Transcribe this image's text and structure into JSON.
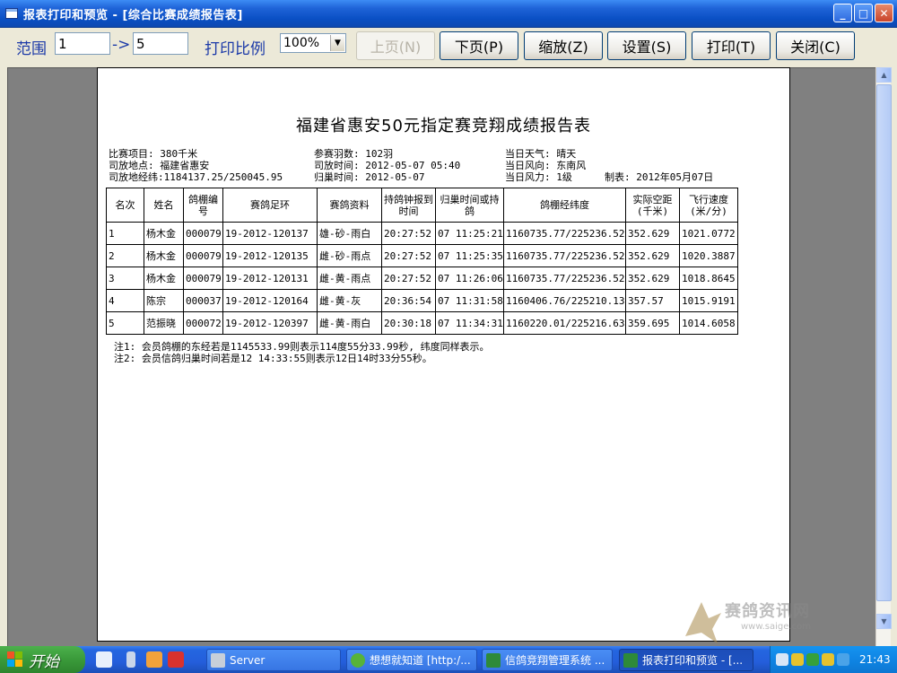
{
  "window": {
    "title": "报表打印和预览 - [综合比赛成绩报告表]",
    "minimize": "_",
    "maximize": "□",
    "close": "✕"
  },
  "toolbar": {
    "range_label": "范围",
    "range_from": "1",
    "range_arrow": "->",
    "range_to": "5",
    "scale_label": "打印比例",
    "scale_value": "100%",
    "prev_page": "上页(N)",
    "next_page": "下页(P)",
    "zoom": "缩放(Z)",
    "settings": "设置(S)",
    "print": "打印(T)",
    "close": "关闭(C)"
  },
  "report": {
    "title": "福建省惠安50元指定赛竞翔成绩报告表",
    "info_left": [
      "比赛项目: 380千米",
      "司放地点: 福建省惠安",
      "司放地经纬:1184137.25/250045.95"
    ],
    "info_mid": [
      "参赛羽数: 102羽",
      "司放时间: 2012-05-07 05:40",
      "归巢时间: 2012-05-07"
    ],
    "info_right": [
      "当日天气: 晴天",
      "当日风向: 东南风",
      "当日风力: 1级"
    ],
    "made_on": "制表: 2012年05月07日",
    "columns": [
      "名次",
      "姓名",
      "鸽棚编号",
      "赛鸽足环",
      "赛鸽资料",
      "持鸽钟报到时间",
      "归巢时间或持鸽",
      "鸽棚经纬度",
      "实际空距(千米)",
      "飞行速度(米/分)"
    ],
    "rows": [
      [
        "1",
        "杨木金",
        "000079",
        "19-2012-120137",
        "雄-砂-雨白",
        "20:27:52",
        "07 11:25:21",
        "1160735.77/225236.52",
        "352.629",
        "1021.0772"
      ],
      [
        "2",
        "杨木金",
        "000079",
        "19-2012-120135",
        "雌-砂-雨点",
        "20:27:52",
        "07 11:25:35",
        "1160735.77/225236.52",
        "352.629",
        "1020.3887"
      ],
      [
        "3",
        "杨木金",
        "000079",
        "19-2012-120131",
        "雌-黄-雨点",
        "20:27:52",
        "07 11:26:06",
        "1160735.77/225236.52",
        "352.629",
        "1018.8645"
      ],
      [
        "4",
        "陈宗",
        "000037",
        "19-2012-120164",
        "雌-黄-灰",
        "20:36:54",
        "07 11:31:58",
        "1160406.76/225210.13",
        "357.57",
        "1015.9191"
      ],
      [
        "5",
        "范振晓",
        "000072",
        "19-2012-120397",
        "雌-黄-雨白",
        "20:30:18",
        "07 11:34:31",
        "1160220.01/225216.63",
        "359.695",
        "1014.6058"
      ]
    ],
    "notes": [
      "注1: 会员鸽棚的东经若是1145533.99则表示114度55分33.99秒, 纬度同样表示。",
      "注2: 会员信鸽归巢时间若是12 14:33:55则表示12日14时33分55秒。"
    ]
  },
  "watermark": {
    "name": "赛鸽资讯网",
    "url": "www.saige.com"
  },
  "taskbar": {
    "start": "开始",
    "tasks": [
      "Server",
      "想想就知道 [http:/...",
      "信鸽竞翔管理系统 ...",
      "报表打印和预览 - [..."
    ],
    "clock": "21:43"
  }
}
